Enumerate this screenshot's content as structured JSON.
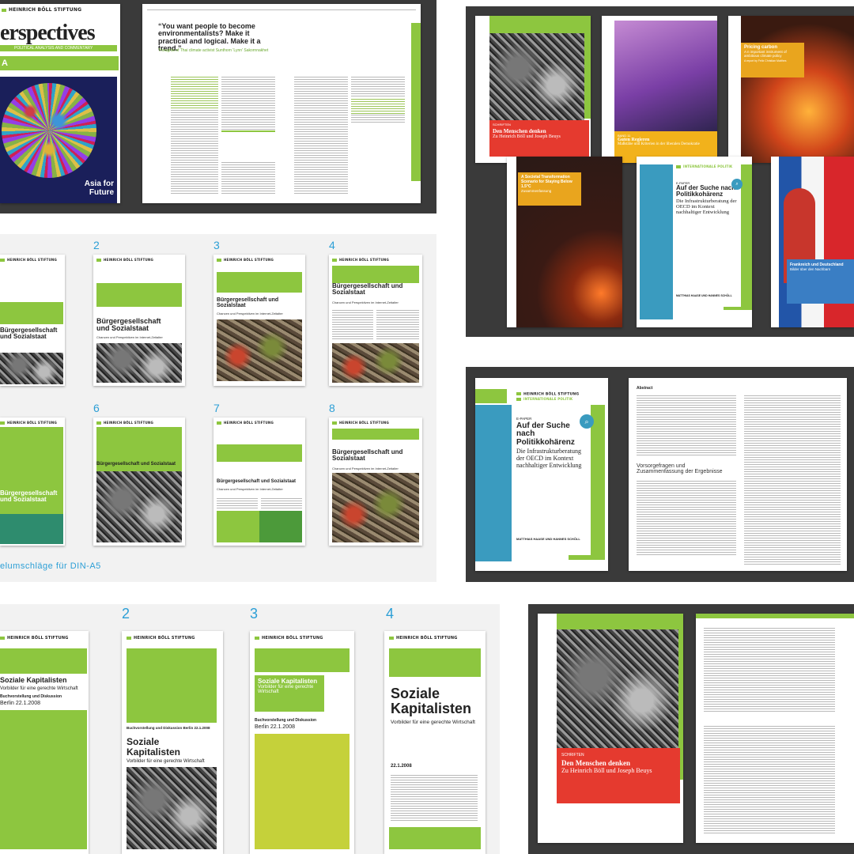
{
  "p1": {
    "logo": "HEINRICH BÖLL STIFTUNG",
    "mag_title": "erspectives",
    "mag_subtitle": "POLITICAL ANALYSIS AND COMMENTARY",
    "mag_cover_tag": "A",
    "mag_cover_text": "Asia for Future",
    "quote_title": "“You want people to become environmentalists? Make it practical and logical. Make it a trend.”",
    "quote_sub": "Thoughts of Thai climate activist Sunthorn 'Lynn' Sakornnakhet"
  },
  "p2": {
    "cover1_series": "SCHRIFTEN",
    "cover1_title": "Den Menschen denken",
    "cover1_sub": "Zu Heinrich Böll und Joseph Beuys",
    "cover3_title": "Pricing carbon",
    "cover3_sub": "A n important instrument of ambitious climate policy",
    "cover3_author": "A report by Felix Christian Matthes",
    "cover2_series": "BAND 11",
    "cover2_title": "Guten Regieren",
    "cover2_sub": "Maßstäbe und Kriterien in der liberalen Demokratie",
    "cover4_title": "A Societal Transformation Scenario for Staying Below 1.5°C",
    "cover4_sub": "Zusammenfassung",
    "cover5_logo": "INTERNATIONALE POLITIK",
    "cover5_series": "E-PAPER",
    "cover5_title": "Auf der Suche nach Politikkohärenz",
    "cover5_sub": "Die Infrastrukturberatung der OECD im Kontext nachhaltiger Entwicklung",
    "cover5_footer": "MATTHIAS HAASE UND HANNES SCHÖLL",
    "cover6_title": "Frankreich und Deutschland",
    "cover6_sub": "Bilder über den Nachbarn"
  },
  "p3": {
    "numbers": [
      "2",
      "3",
      "4",
      "6",
      "7",
      "8"
    ],
    "title_a": "Bürgergesellschaft und Sozialstaat",
    "title_b": "Bürgergesellschaft und Sozialstaat",
    "subtitle": "Chancen und Perspektiven im Internet-Zeitalter",
    "caption": "elumschläge für DIN-A5"
  },
  "p4": {
    "sub_heading": "Vorsorgefragen und Zusammenfassung der Ergebnisse",
    "abstract_label": "Abstract"
  },
  "p5": {
    "numbers": [
      "2",
      "3",
      "4"
    ],
    "title1": "Soziale Kapitalisten",
    "title1_sub": "Vorbilder für eine gerechte Wirtschaft",
    "title1_meta": "Buchvorstellung und Diskussion",
    "title1_date": "Berlin 22.1.2008",
    "title2_meta": "Buchvorstellung und Diskussion Berlin 22.1.2008",
    "title2": "Soziale Kapitalisten",
    "title2_sub": "Vorbilder für eine gerechte Wirtschaft",
    "title3": "Soziale Kapitalisten",
    "title3_sub": "Vorbilder für eine gerechte Wirtschaft",
    "title3_meta": "Buchvorstellung und Diskussion",
    "title3_date": "Berlin 22.1.2008",
    "title4": "Soziale Kapitalisten",
    "title4_sub": "Vorbilder für eine gerechte Wirtschaft",
    "title4_date": "22.1.2008"
  },
  "p6": {
    "series": "SCHRIFTEN",
    "title": "Den Menschen denken",
    "sub": "Zu Heinrich Böll und Joseph Beuys"
  }
}
